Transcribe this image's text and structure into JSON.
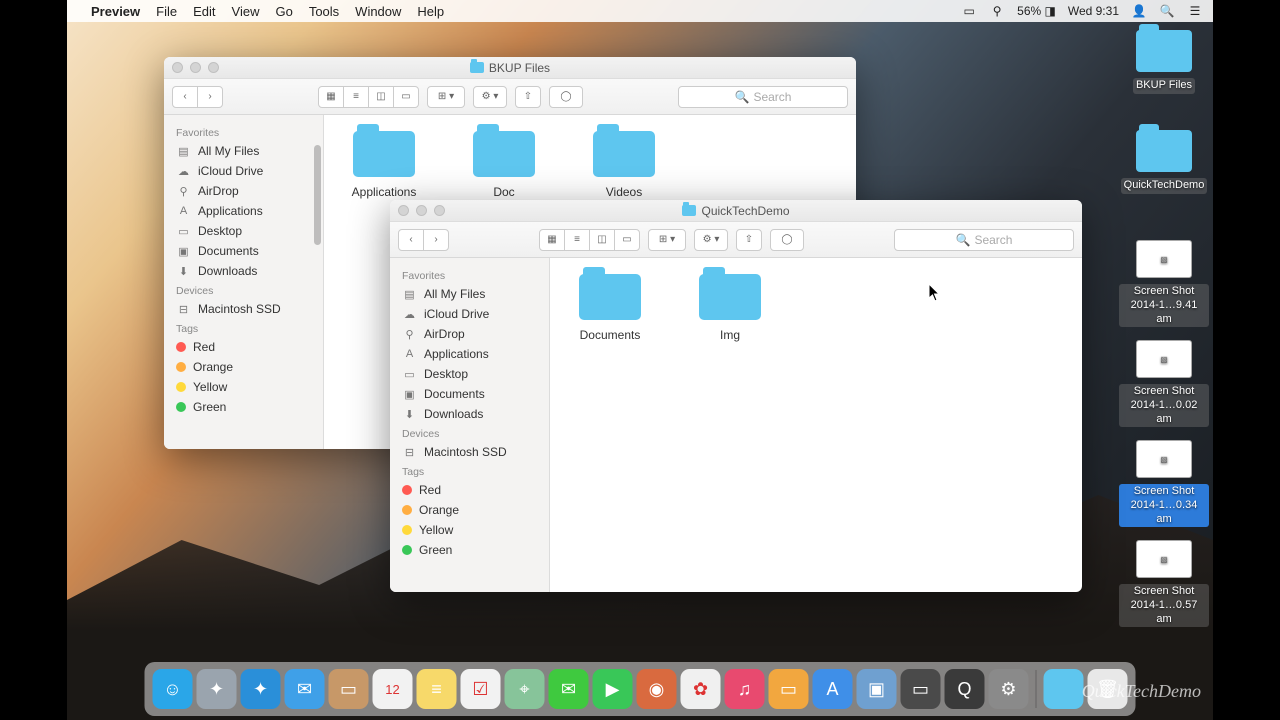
{
  "menubar": {
    "app": "Preview",
    "items": [
      "File",
      "Edit",
      "View",
      "Go",
      "Tools",
      "Window",
      "Help"
    ],
    "battery": "56%",
    "clock": "Wed 9:31"
  },
  "sidebar": {
    "sections": {
      "favorites": "Favorites",
      "devices": "Devices",
      "tags": "Tags"
    },
    "favorites": [
      "All My Files",
      "iCloud Drive",
      "AirDrop",
      "Applications",
      "Desktop",
      "Documents",
      "Downloads"
    ],
    "devices": [
      "Macintosh SSD"
    ],
    "tags": [
      {
        "name": "Red",
        "color": "#ff5a52"
      },
      {
        "name": "Orange",
        "color": "#ffae42"
      },
      {
        "name": "Yellow",
        "color": "#ffd93b"
      },
      {
        "name": "Green",
        "color": "#39c758"
      }
    ]
  },
  "window1": {
    "title": "BKUP Files",
    "items": [
      "Applications",
      "Doc",
      "Videos"
    ]
  },
  "window2": {
    "title": "QuickTechDemo",
    "items": [
      "Documents",
      "Img"
    ]
  },
  "desktop": {
    "items": [
      {
        "name": "BKUP Files",
        "type": "folder"
      },
      {
        "name": "QuickTechDemo",
        "type": "folder"
      },
      {
        "name": "Screen Shot 2014-1…9.41 am",
        "type": "thumb"
      },
      {
        "name": "Screen Shot 2014-1…0.02 am",
        "type": "thumb"
      },
      {
        "name": "Screen Shot 2014-1…0.34 am",
        "type": "thumb",
        "sel": true
      },
      {
        "name": "Screen Shot 2014-1…0.57 am",
        "type": "thumb"
      }
    ]
  },
  "search_placeholder": "Search",
  "watermark": "QuickTechDemo",
  "dock": [
    {
      "n": "finder",
      "c": "#2aa6e8",
      "t": "☺"
    },
    {
      "n": "launchpad",
      "c": "#9aa4ae",
      "t": "✦"
    },
    {
      "n": "safari",
      "c": "#2a8fd9",
      "t": "✦"
    },
    {
      "n": "mail",
      "c": "#3fa0e8",
      "t": "✉"
    },
    {
      "n": "contacts",
      "c": "#c79868",
      "t": "▭"
    },
    {
      "n": "calendar",
      "c": "#f2f2f2",
      "t": "12"
    },
    {
      "n": "notes",
      "c": "#f7d96a",
      "t": "≡"
    },
    {
      "n": "reminders",
      "c": "#f2f2f2",
      "t": "☑"
    },
    {
      "n": "maps",
      "c": "#87c49a",
      "t": "⌖"
    },
    {
      "n": "messages",
      "c": "#3fc93f",
      "t": "✉"
    },
    {
      "n": "facetime",
      "c": "#39c758",
      "t": "▶"
    },
    {
      "n": "photobooth",
      "c": "#d96a3f",
      "t": "◉"
    },
    {
      "n": "photos",
      "c": "#f0f0f0",
      "t": "✿"
    },
    {
      "n": "itunes",
      "c": "#e84a6f",
      "t": "♫"
    },
    {
      "n": "ibooks",
      "c": "#f2a73f",
      "t": "▭"
    },
    {
      "n": "appstore",
      "c": "#3f8fe8",
      "t": "A"
    },
    {
      "n": "preview",
      "c": "#6fa0d0",
      "t": "▣"
    },
    {
      "n": "dictionary",
      "c": "#4a4a4a",
      "t": "▭"
    },
    {
      "n": "quicktime",
      "c": "#3a3a3a",
      "t": "Q"
    },
    {
      "n": "prefs",
      "c": "#8a8a8a",
      "t": "⚙"
    }
  ],
  "dock_right": [
    {
      "n": "downloads",
      "c": "#5ec6ef",
      "t": ""
    },
    {
      "n": "trash",
      "c": "#e8e8e8",
      "t": "🗑"
    }
  ]
}
